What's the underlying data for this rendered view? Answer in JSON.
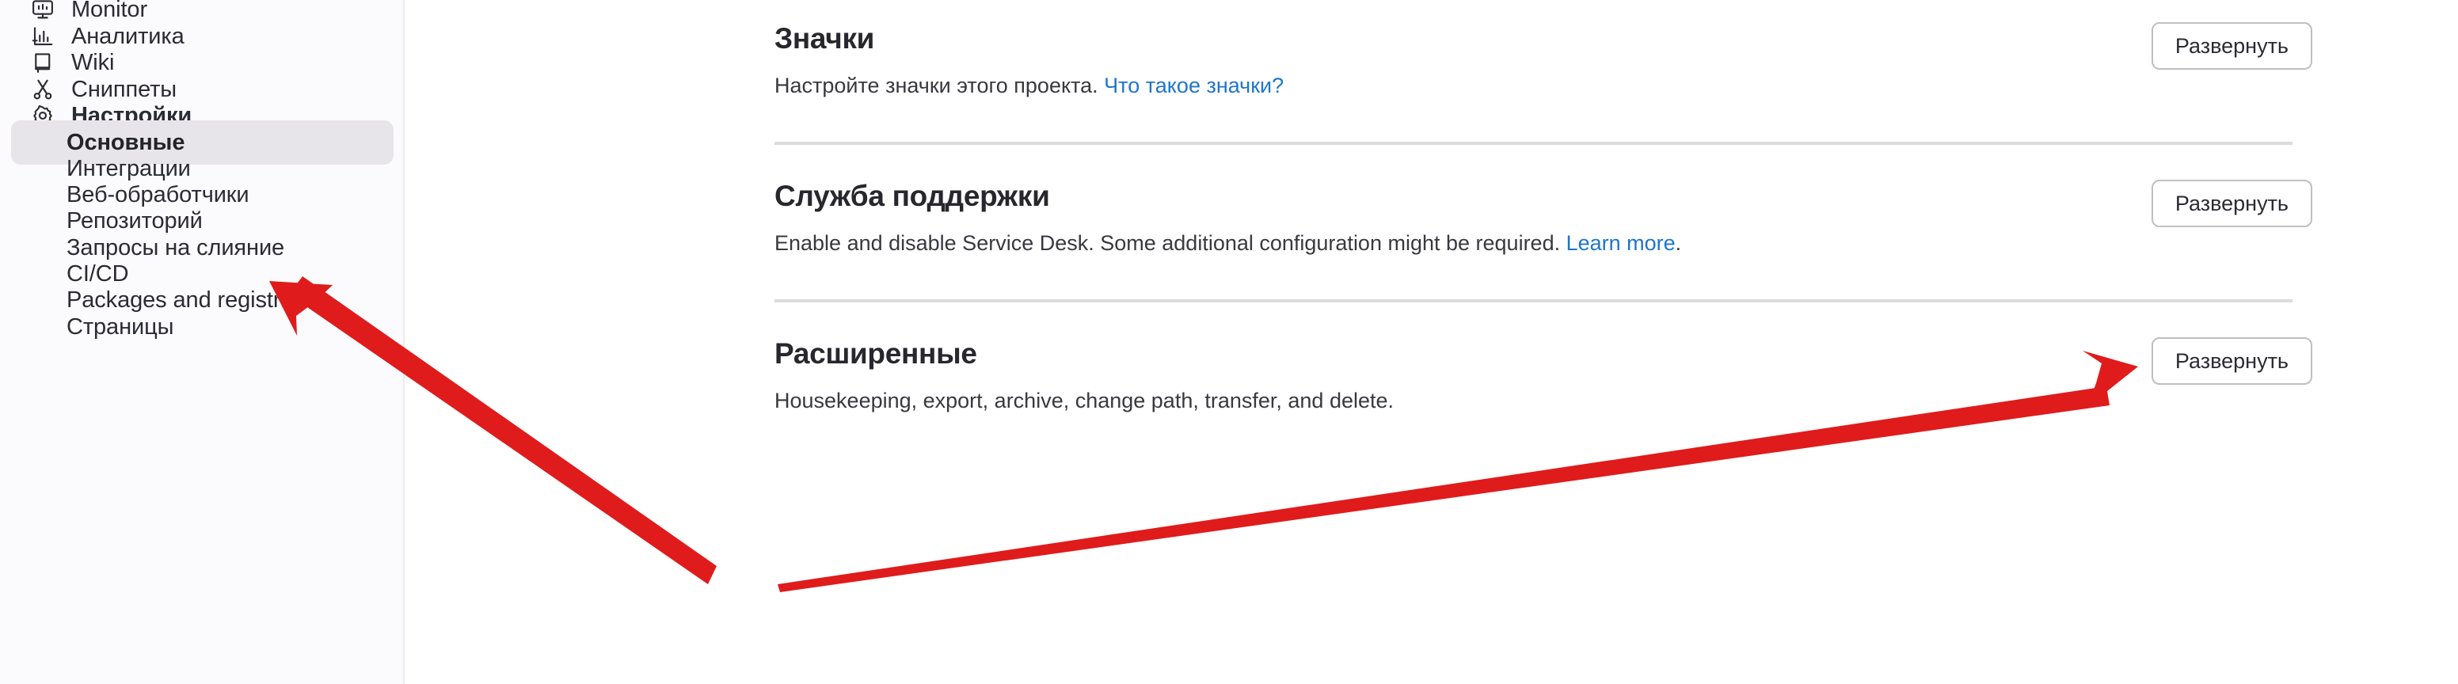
{
  "sidebar": {
    "items": [
      {
        "label": "Monitor",
        "icon": "monitor-icon",
        "type": "top",
        "active": false,
        "bold": false
      },
      {
        "label": "Аналитика",
        "icon": "analytics-icon",
        "type": "top",
        "active": false,
        "bold": false
      },
      {
        "label": "Wiki",
        "icon": "wiki-icon",
        "type": "top",
        "active": false,
        "bold": false
      },
      {
        "label": "Сниппеты",
        "icon": "scissors-icon",
        "type": "top",
        "active": false,
        "bold": false
      },
      {
        "label": "Настройки",
        "icon": "gear-icon",
        "type": "top",
        "active": false,
        "bold": true
      },
      {
        "label": "Основные",
        "icon": "",
        "type": "sub",
        "active": true,
        "bold": true
      },
      {
        "label": "Интеграции",
        "icon": "",
        "type": "sub",
        "active": false,
        "bold": false
      },
      {
        "label": "Веб-обработчики",
        "icon": "",
        "type": "sub",
        "active": false,
        "bold": false
      },
      {
        "label": "Репозиторий",
        "icon": "",
        "type": "sub",
        "active": false,
        "bold": false
      },
      {
        "label": "Запросы на слияние",
        "icon": "",
        "type": "sub",
        "active": false,
        "bold": false
      },
      {
        "label": "CI/CD",
        "icon": "",
        "type": "sub",
        "active": false,
        "bold": false
      },
      {
        "label": "Packages and registries",
        "icon": "",
        "type": "sub",
        "active": false,
        "bold": false
      },
      {
        "label": "Страницы",
        "icon": "",
        "type": "sub",
        "active": false,
        "bold": false
      }
    ]
  },
  "main": {
    "sections": [
      {
        "title": "Значки",
        "desc_before": "Настройте значки этого проекта. ",
        "link_text": "Что такое значки?",
        "desc_after": "",
        "button_label": "Развернуть"
      },
      {
        "title": "Служба поддержки",
        "desc_before": "Enable and disable Service Desk. Some additional configuration might be required. ",
        "link_text": "Learn more",
        "desc_after": ".",
        "button_label": "Развернуть"
      },
      {
        "title": "Расширенные",
        "desc_before": "Housekeeping, export, archive, change path, transfer, and delete.",
        "link_text": "",
        "desc_after": "",
        "button_label": "Развернуть"
      }
    ]
  },
  "annotations": {
    "arrows": [
      {
        "name": "arrow-to-osnovnye",
        "color": "#E01B1B"
      },
      {
        "name": "arrow-to-expand-advanced",
        "color": "#E01B1B"
      }
    ]
  },
  "colors": {
    "link": "#1f75cb",
    "annotation_red": "#E01B1B",
    "sidebar_bg": "#fbfafd",
    "active_item_bg": "#e7e5ea",
    "divider": "#dcdcde"
  }
}
